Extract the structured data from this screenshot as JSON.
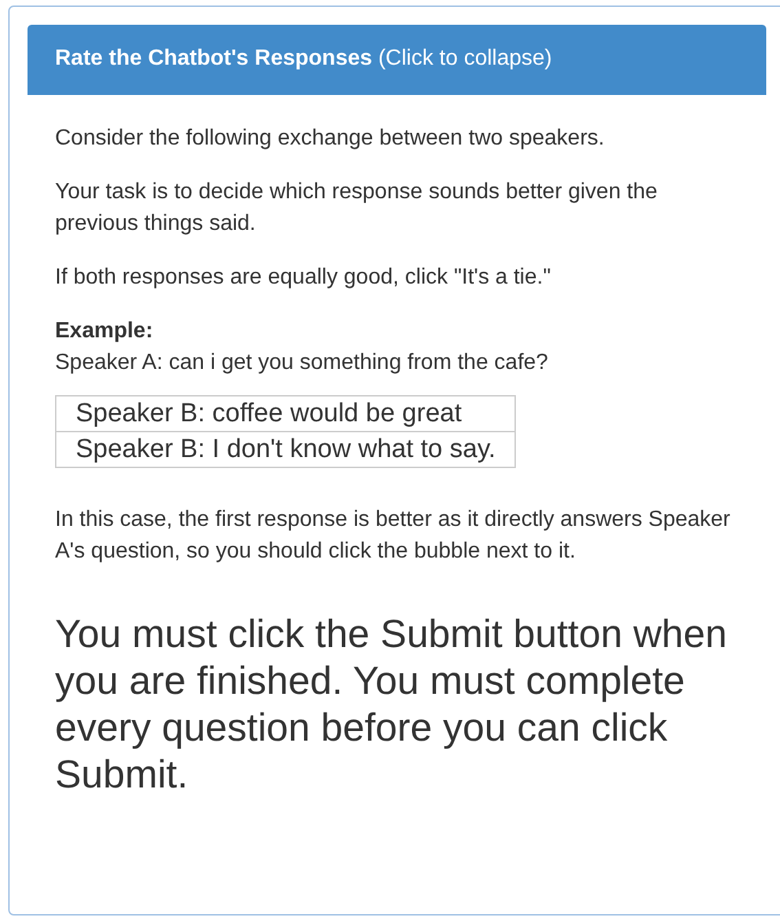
{
  "panel": {
    "heading": "**Rate the Chatbot's Responses** (Click to collapse)"
  },
  "instructions": [
    "Consider the following exchange between two speakers.",
    "Your task is to decide which response sounds better given the previous things said.",
    "If both responses are equally good, click \"It's a tie.\""
  ],
  "example": {
    "label": "Example:",
    "prompt": "Speaker A: can i get you something from the cafe?",
    "responses": [
      "Speaker B: coffee would be great",
      "Speaker B: I don't know what to say."
    ],
    "explanation": "In this case, the first response is better as it directly answers Speaker A's question, so you should click the bubble next to it."
  },
  "notice": "You must click the Submit button when you are finished. You must complete every question before you can click Submit."
}
